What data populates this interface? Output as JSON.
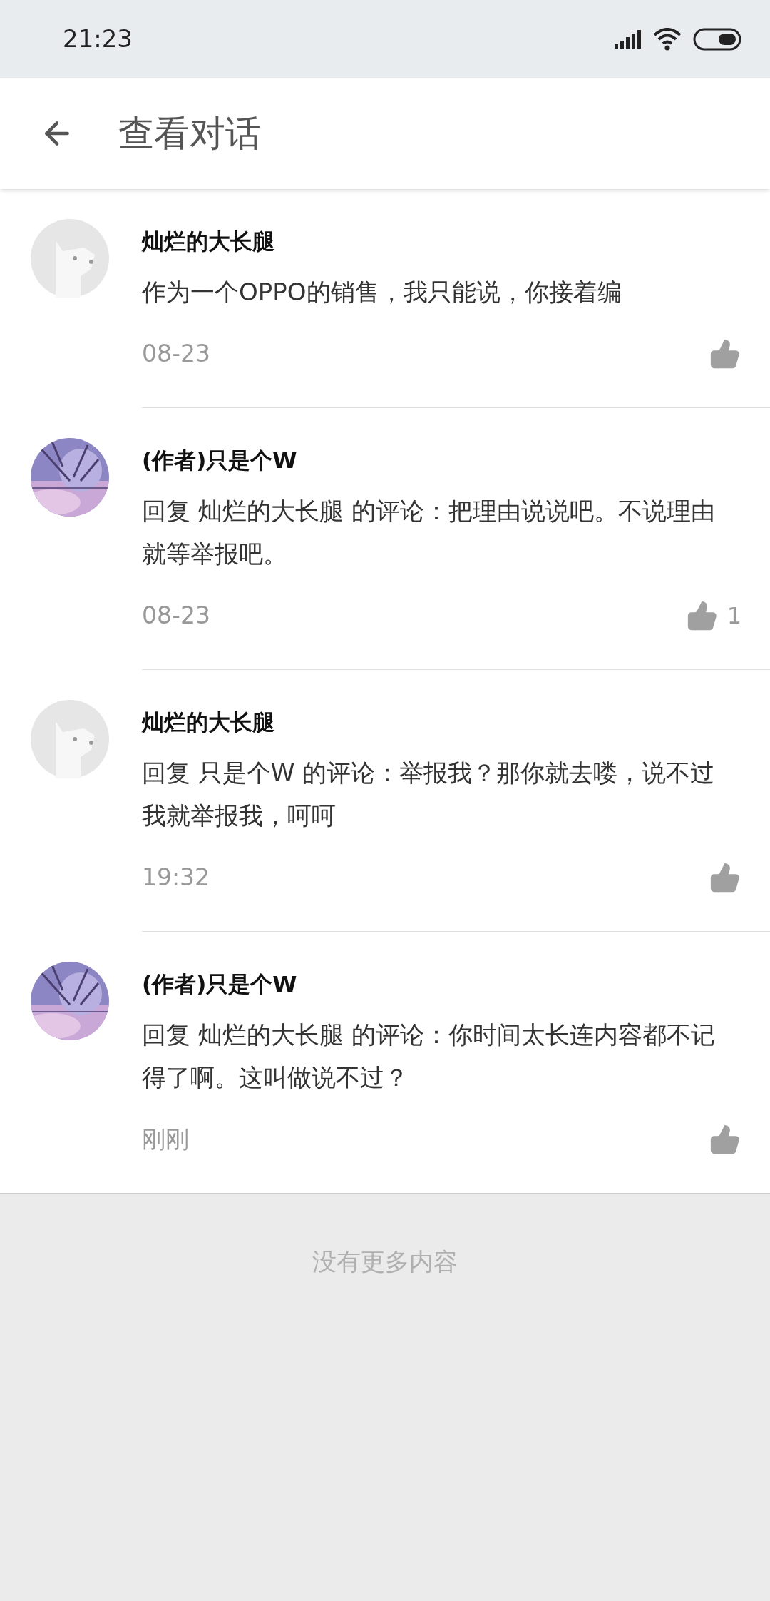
{
  "status_bar": {
    "time": "21:23"
  },
  "header": {
    "title": "查看对话"
  },
  "comments": [
    {
      "author": "灿烂的大长腿",
      "avatar": {
        "kind": "default"
      },
      "text": "作为一个OPPO的销售，我只能说，你接着编",
      "time": "08-23"
    },
    {
      "author": "(作者)只是个W",
      "text": "回复 灿烂的大长腿 的评论：把理由说说吧。不说理由就等举报吧。",
      "time": "08-23",
      "likes": "1"
    },
    {
      "author": "灿烂的大长腿",
      "avatar": {
        "kind": "default"
      },
      "text": "回复 只是个W 的评论：举报我？那你就去喽，说不过我就举报我，呵呵",
      "time": "19:32"
    },
    {
      "author": "(作者)只是个W",
      "text": "回复 灿烂的大长腿 的评论：你时间太长连内容都不记得了啊。这叫做说不过？",
      "time": "刚刚"
    }
  ],
  "footer": {
    "text": "没有更多内容"
  }
}
